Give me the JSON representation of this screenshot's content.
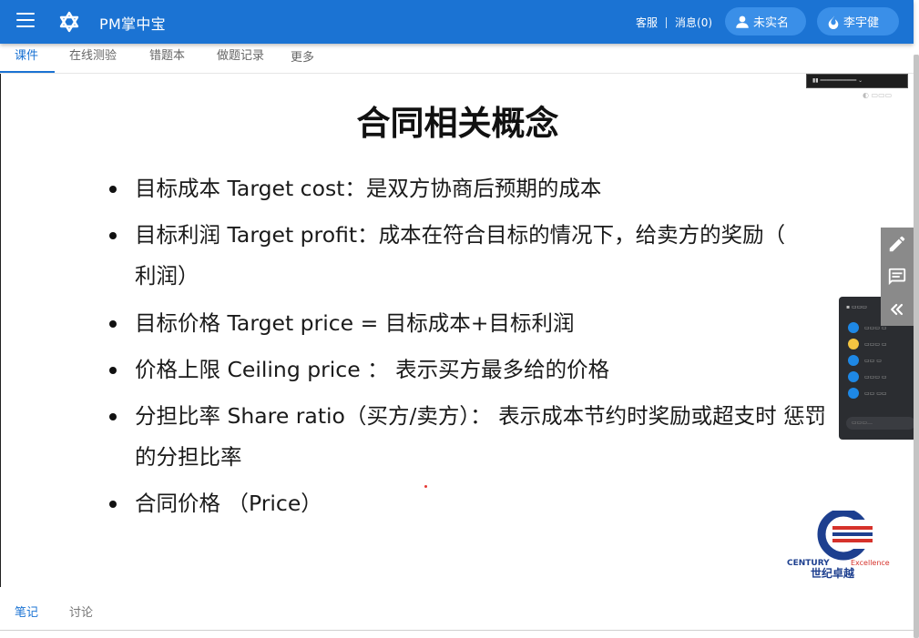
{
  "appbar": {
    "title": "PM掌中宝",
    "customer_service": "客服",
    "messages": "消息(0)",
    "verify_label": "未实名",
    "user_name": "李宇健",
    "bar_color": "#1b73d3",
    "pill_color": "#3a8fe8"
  },
  "tabs": [
    {
      "label": "课件",
      "active": true
    },
    {
      "label": "在线测验",
      "active": false
    },
    {
      "label": "错题本",
      "active": false
    },
    {
      "label": "做题记录",
      "active": false
    },
    {
      "label": "更多",
      "active": false
    }
  ],
  "slide": {
    "title": "合同相关概念",
    "bullets": [
      {
        "text": "目标成本 Target cost：是双方协商后预期的成本"
      },
      {
        "text": "目标利润  Target profit：成本在符合目标的情况下，给卖方的奖励（",
        "text2": "利润）"
      },
      {
        "text": "目标价格 Target price = 目标成本+目标利润"
      },
      {
        "text": "价格上限 Ceiling  price ： 表示买方最多给的价格"
      },
      {
        "text": "分担比率 Share ratio（买方/卖方）： 表示成本节约时奖励或超支时",
        "text2": "惩罚的分担比率"
      },
      {
        "text": "合同价格  （Price）"
      }
    ]
  },
  "logo": {
    "brand": "CENTURY",
    "brand_suffix": "Excellence",
    "chinese": "世纪卓越"
  },
  "side_tools": [
    {
      "icon": "pencil-icon"
    },
    {
      "icon": "comment-icon"
    },
    {
      "icon": "double-chevron-left-icon"
    }
  ],
  "bottom_tabs": [
    {
      "label": "笔记",
      "active": true
    },
    {
      "label": "讨论",
      "active": false
    }
  ]
}
